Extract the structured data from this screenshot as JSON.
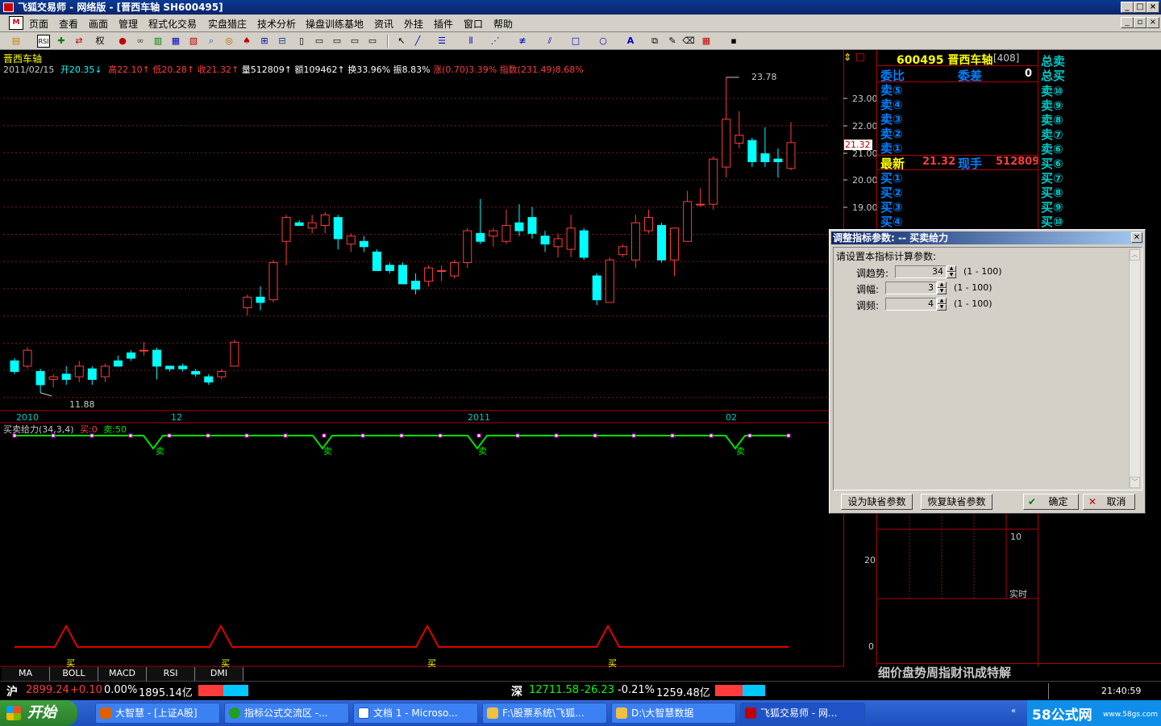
{
  "window": {
    "title": "飞狐交易师 - 网络版 - [晋西车轴 SH600495]",
    "buttons": [
      "_",
      "□",
      "×"
    ]
  },
  "menu": {
    "items": [
      "页面",
      "查看",
      "画面",
      "管理",
      "程式化交易",
      "实盘猎庄",
      "技术分析",
      "操盘训练基地",
      "资讯",
      "外挂",
      "插件",
      "窗口",
      "帮助"
    ]
  },
  "chart": {
    "stock_name": "晋西车轴",
    "info": {
      "date": "2011/02/15",
      "open": "开20.35",
      "high": "高22.10",
      "low": "低20.28",
      "close": "收21.32",
      "volume": "量512809",
      "amount": "额109462",
      "turnover": "换33.96%",
      "amplitude": "振8.83%",
      "change": "涨(0.70)3.39%",
      "index": "指数(231.49)8.68%"
    },
    "y_ticks": [
      "23.00",
      "22.00",
      "21.00",
      "20.00",
      "19.00"
    ],
    "high_label": "23.78",
    "low_label": "11.88",
    "last_price_tag": "21.32",
    "x_ticks": [
      "2010",
      "12",
      "2011",
      "02"
    ],
    "indicator_title": "买卖给力(34,3,4)",
    "indicator_buy": "买:0",
    "indicator_sell": "卖:50",
    "sell_marks": [
      "卖",
      "卖",
      "卖",
      "卖"
    ],
    "buy_marks": [
      "买",
      "买",
      "买",
      "买"
    ],
    "right_axis": [
      "20",
      "0"
    ]
  },
  "chart_data": {
    "type": "candlestick",
    "ylim": [
      11.5,
      24.2
    ],
    "candles": [
      {
        "o": 13.1,
        "c": 12.7,
        "h": 13.2,
        "l": 12.6
      },
      {
        "o": 12.9,
        "c": 13.5,
        "h": 13.6,
        "l": 12.8
      },
      {
        "o": 12.7,
        "c": 12.2,
        "h": 12.8,
        "l": 11.9
      },
      {
        "o": 12.4,
        "c": 12.5,
        "h": 12.6,
        "l": 12.1
      },
      {
        "o": 12.6,
        "c": 12.4,
        "h": 12.9,
        "l": 12.2
      },
      {
        "o": 12.5,
        "c": 12.9,
        "h": 13.1,
        "l": 12.3
      },
      {
        "o": 12.8,
        "c": 12.4,
        "h": 12.9,
        "l": 12.2
      },
      {
        "o": 12.5,
        "c": 12.9,
        "h": 13.0,
        "l": 12.3
      },
      {
        "o": 13.1,
        "c": 12.9,
        "h": 13.3,
        "l": 12.9
      },
      {
        "o": 13.4,
        "c": 13.2,
        "h": 13.5,
        "l": 13.1
      },
      {
        "o": 13.5,
        "c": 13.5,
        "h": 13.8,
        "l": 13.3
      },
      {
        "o": 13.5,
        "c": 12.9,
        "h": 13.6,
        "l": 12.4
      },
      {
        "o": 12.9,
        "c": 12.8,
        "h": 12.9,
        "l": 12.7
      },
      {
        "o": 12.9,
        "c": 12.8,
        "h": 13.0,
        "l": 12.7
      },
      {
        "o": 12.7,
        "c": 12.6,
        "h": 12.8,
        "l": 12.5
      },
      {
        "o": 12.5,
        "c": 12.3,
        "h": 12.6,
        "l": 12.2
      },
      {
        "o": 12.5,
        "c": 12.7,
        "h": 12.8,
        "l": 12.4
      },
      {
        "o": 12.9,
        "c": 13.8,
        "h": 13.9,
        "l": 12.9
      },
      {
        "o": 15.1,
        "c": 15.5,
        "h": 15.6,
        "l": 14.8
      },
      {
        "o": 15.5,
        "c": 15.3,
        "h": 15.9,
        "l": 15.0
      },
      {
        "o": 15.4,
        "c": 16.8,
        "h": 16.9,
        "l": 15.3
      },
      {
        "o": 17.6,
        "c": 18.5,
        "h": 18.6,
        "l": 16.7
      },
      {
        "o": 18.3,
        "c": 18.2,
        "h": 18.4,
        "l": 18.2
      },
      {
        "o": 18.1,
        "c": 18.3,
        "h": 18.6,
        "l": 17.9
      },
      {
        "o": 18.2,
        "c": 18.6,
        "h": 18.7,
        "l": 17.9
      },
      {
        "o": 18.5,
        "c": 17.7,
        "h": 18.6,
        "l": 17.3
      },
      {
        "o": 17.5,
        "c": 17.8,
        "h": 17.9,
        "l": 17.2
      },
      {
        "o": 17.6,
        "c": 17.4,
        "h": 17.8,
        "l": 17.2
      },
      {
        "o": 17.2,
        "c": 16.5,
        "h": 17.3,
        "l": 16.5
      },
      {
        "o": 16.7,
        "c": 16.5,
        "h": 16.8,
        "l": 16.4
      },
      {
        "o": 16.7,
        "c": 16.0,
        "h": 16.8,
        "l": 16.0
      },
      {
        "o": 16.1,
        "c": 15.8,
        "h": 16.4,
        "l": 15.6
      },
      {
        "o": 16.1,
        "c": 16.6,
        "h": 16.7,
        "l": 15.9
      },
      {
        "o": 16.5,
        "c": 16.5,
        "h": 16.7,
        "l": 16.1
      },
      {
        "o": 16.3,
        "c": 16.8,
        "h": 16.9,
        "l": 16.2
      },
      {
        "o": 16.8,
        "c": 18.0,
        "h": 18.1,
        "l": 16.6
      },
      {
        "o": 17.9,
        "c": 17.6,
        "h": 19.2,
        "l": 17.5
      },
      {
        "o": 17.8,
        "c": 18.0,
        "h": 18.1,
        "l": 17.4
      },
      {
        "o": 17.6,
        "c": 18.2,
        "h": 18.8,
        "l": 17.5
      },
      {
        "o": 18.3,
        "c": 18.0,
        "h": 19.0,
        "l": 17.8
      },
      {
        "o": 18.5,
        "c": 17.9,
        "h": 18.9,
        "l": 17.7
      },
      {
        "o": 17.8,
        "c": 17.5,
        "h": 18.0,
        "l": 17.2
      },
      {
        "o": 17.4,
        "c": 17.7,
        "h": 17.9,
        "l": 17.0
      },
      {
        "o": 17.3,
        "c": 18.1,
        "h": 18.6,
        "l": 17.0
      },
      {
        "o": 18.0,
        "c": 17.0,
        "h": 18.1,
        "l": 16.9
      },
      {
        "o": 16.3,
        "c": 15.4,
        "h": 16.4,
        "l": 15.2
      },
      {
        "o": 15.3,
        "c": 16.9,
        "h": 17.0,
        "l": 15.3
      },
      {
        "o": 17.1,
        "c": 17.4,
        "h": 17.5,
        "l": 17.0
      },
      {
        "o": 16.9,
        "c": 18.3,
        "h": 18.6,
        "l": 16.6
      },
      {
        "o": 18.0,
        "c": 18.5,
        "h": 18.8,
        "l": 17.9
      },
      {
        "o": 18.2,
        "c": 16.9,
        "h": 18.3,
        "l": 16.8
      },
      {
        "o": 16.9,
        "c": 18.1,
        "h": 18.1,
        "l": 16.3
      },
      {
        "o": 17.6,
        "c": 19.1,
        "h": 19.5,
        "l": 17.6
      },
      {
        "o": 19.0,
        "c": 19.0,
        "h": 19.6,
        "l": 18.9
      },
      {
        "o": 19.0,
        "c": 20.7,
        "h": 20.8,
        "l": 18.8
      },
      {
        "o": 20.4,
        "c": 22.2,
        "h": 23.78,
        "l": 20.0
      },
      {
        "o": 21.3,
        "c": 21.6,
        "h": 22.5,
        "l": 21.1
      },
      {
        "o": 21.4,
        "c": 20.6,
        "h": 21.5,
        "l": 20.4
      },
      {
        "o": 20.9,
        "c": 20.6,
        "h": 21.9,
        "l": 20.4
      },
      {
        "o": 20.7,
        "c": 20.6,
        "h": 21.1,
        "l": 20.0
      },
      {
        "o": 20.35,
        "c": 21.32,
        "h": 22.1,
        "l": 20.28
      }
    ]
  },
  "quote_panel": {
    "code_name": "600495 晋西车轴",
    "count": "[408]",
    "webi_label": "委比",
    "weicha_label": "委差",
    "weicha_value": "0",
    "sell_labels": [
      "卖⑤",
      "卖④",
      "卖③",
      "卖②",
      "卖①"
    ],
    "latest_label": "最新",
    "latest_value": "21.32",
    "current_hand_label": "现手",
    "current_hand_value": "512809",
    "buy_labels": [
      "买①",
      "买②",
      "买③",
      "买④"
    ],
    "total_sell": "总卖",
    "total_buy": "总买",
    "sell_ladder": [
      "卖⑩",
      "卖⑨",
      "卖⑧",
      "卖⑦",
      "卖⑥"
    ],
    "buy_ladder": [
      "买⑥",
      "买⑦",
      "买⑧",
      "买⑨",
      "买⑩"
    ],
    "mini_axis": [
      "10",
      "实时"
    ],
    "bottom_tabs": "细价盘势周指财讯成特解"
  },
  "dialog": {
    "title": "调整指标参数: -- 买卖给力",
    "prompt": "请设置本指标计算参数:",
    "params": [
      {
        "label": "调趋势:",
        "value": "34",
        "range": "(1 - 100)"
      },
      {
        "label": "调幅:",
        "value": "3",
        "range": "(1 - 100)"
      },
      {
        "label": "调频:",
        "value": "4",
        "range": "(1 - 100)"
      }
    ],
    "btn_set_default": "设为缺省参数",
    "btn_restore_default": "恢复缺省参数",
    "btn_ok": "确定",
    "btn_cancel": "取消"
  },
  "bottom_tabs": [
    "MA",
    "BOLL",
    "MACD",
    "RSI",
    "DMI"
  ],
  "status": {
    "sh_label": "沪",
    "sh_value": "2899.24",
    "sh_change": "+0.10",
    "sh_pct": "0.00%",
    "sh_amount": "1895.14亿",
    "sz_label": "深",
    "sz_value": "12711.58",
    "sz_change": "-26.23",
    "sz_pct": "-0.21%",
    "sz_amount": "1259.48亿",
    "time": "21:40:59"
  },
  "taskbar": {
    "start": "开始",
    "tasks": [
      "大智慧 - [上证A股]",
      "指标公式交流区 -...",
      "文档 1 - Microso...",
      "F:\\股票系统\\飞狐...",
      "D:\\大智慧数据",
      "飞狐交易师 - 网..."
    ],
    "tray_brand": "58公式网",
    "tray_url": "www.58gs.com"
  },
  "colors": {
    "up": "#ff3c3c",
    "down": "#00ffff",
    "grid": "#7a1a1a",
    "indicator_line": "#00e000",
    "signal_line": "#e00000"
  }
}
